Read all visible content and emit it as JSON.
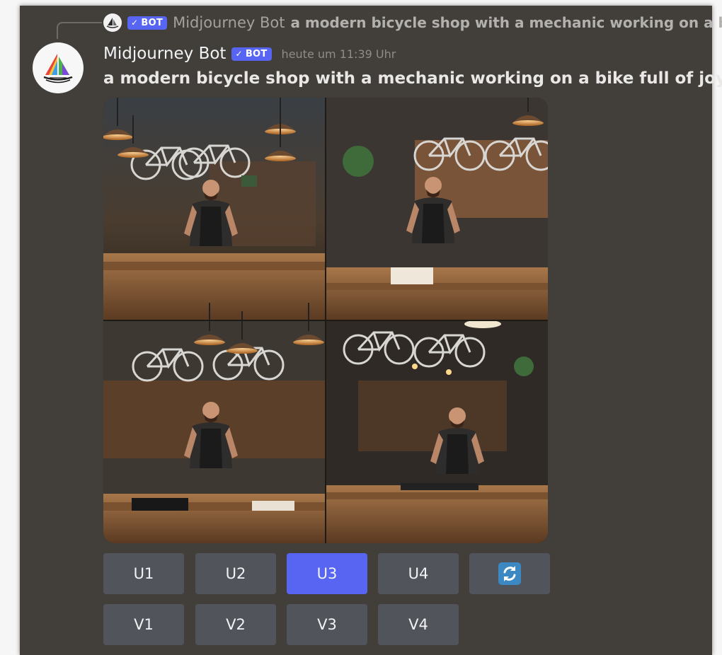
{
  "reply": {
    "bot_badge": "BOT",
    "author": "Midjourney Bot",
    "text": "a modern bicycle shop with a mechanic working on a bike full of joy"
  },
  "message": {
    "author": "Midjourney Bot",
    "bot_badge": "BOT",
    "timestamp": "heute um 11:39 Uhr",
    "prompt": "a modern bicycle shop with a mechanic working on a bike full of joy -"
  },
  "colors": {
    "background": "#423f3b",
    "accent": "#5865f2",
    "button": "#52545b"
  },
  "buttons": {
    "upscale": [
      {
        "label": "U1",
        "active": false
      },
      {
        "label": "U2",
        "active": false
      },
      {
        "label": "U3",
        "active": true
      },
      {
        "label": "U4",
        "active": false
      }
    ],
    "reroll_icon": "refresh-icon",
    "variation": [
      {
        "label": "V1"
      },
      {
        "label": "V2"
      },
      {
        "label": "V3"
      },
      {
        "label": "V4"
      }
    ]
  }
}
